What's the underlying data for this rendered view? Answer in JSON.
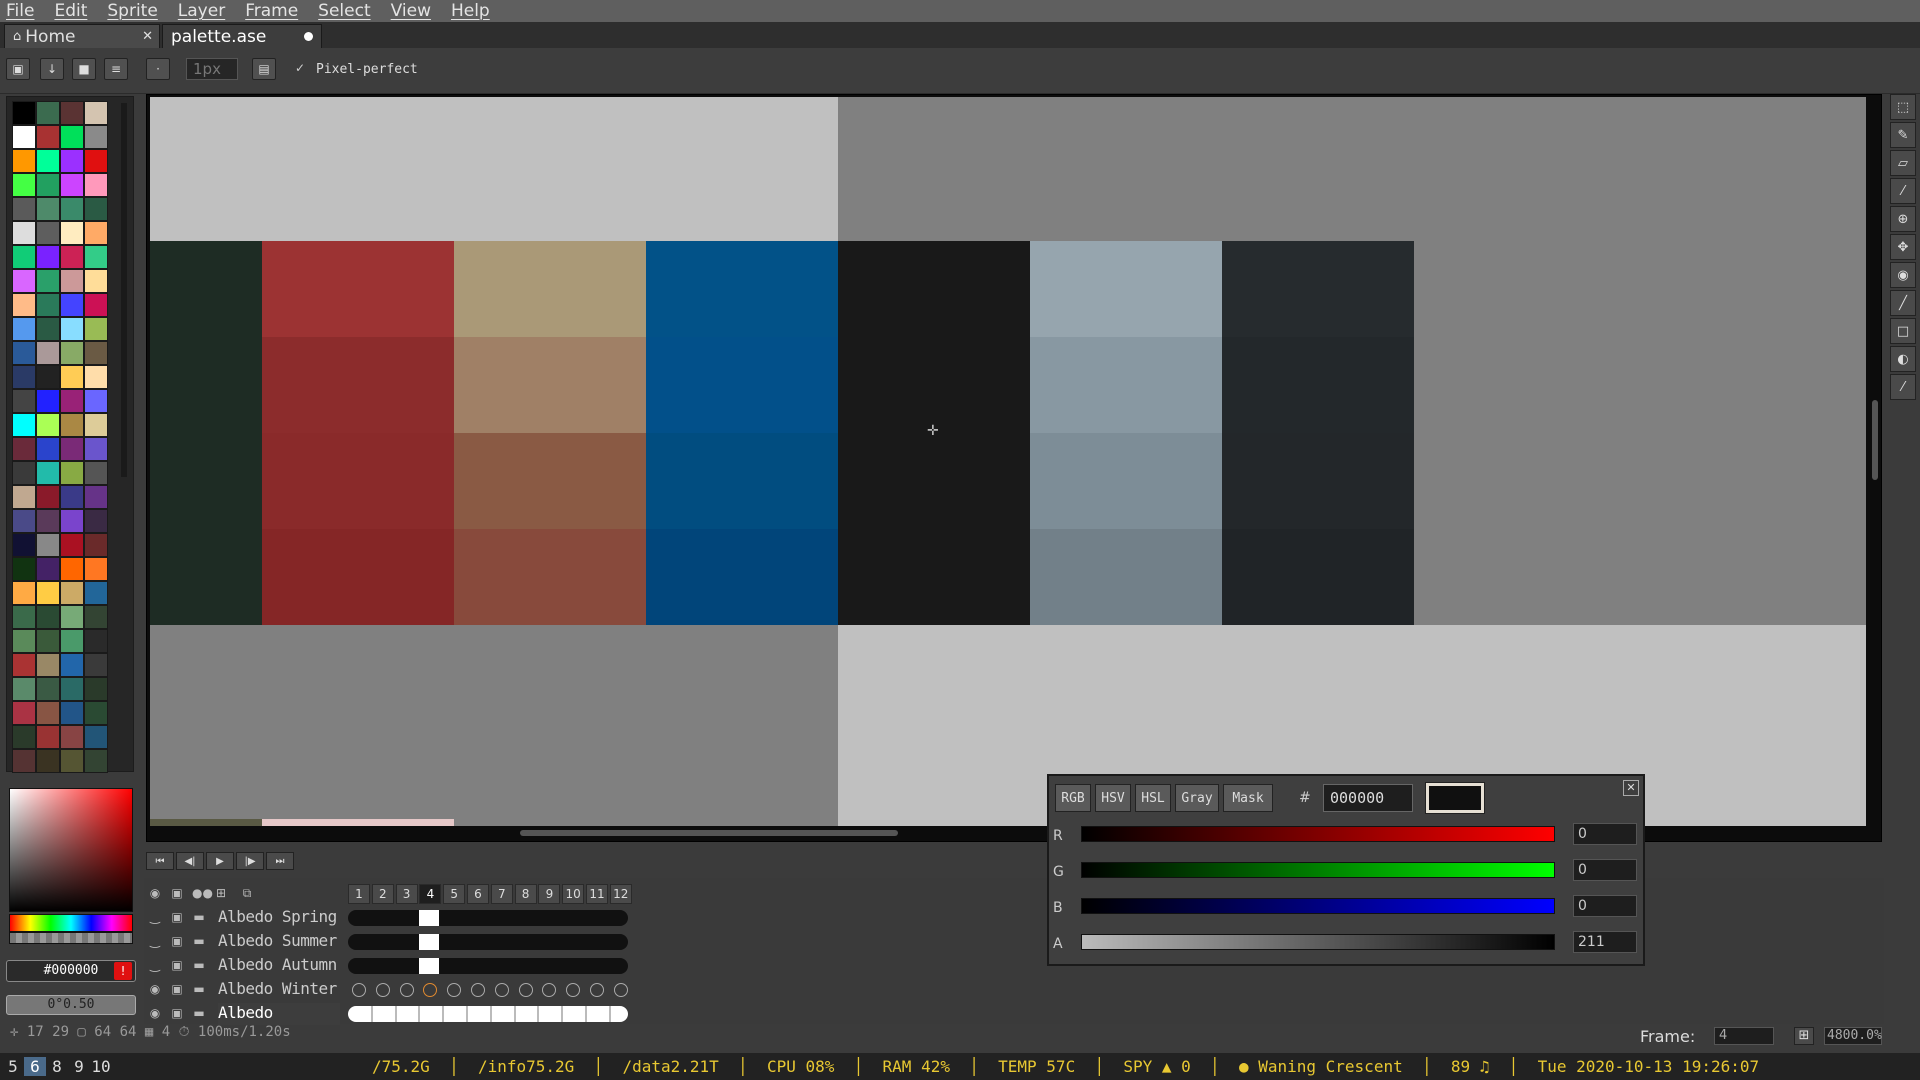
{
  "menu": [
    "File",
    "Edit",
    "Sprite",
    "Layer",
    "Frame",
    "Select",
    "View",
    "Help"
  ],
  "tabs": {
    "home": "Home",
    "file": "palette.ase"
  },
  "toolbar": {
    "brush_size": "1px",
    "pixel_perfect": "Pixel-perfect"
  },
  "palette": [
    "#000000",
    "#3b6b4f",
    "#5a3333",
    "#d4c4b0",
    "#ffffff",
    "#a83232",
    "#00e05a",
    "#8a8a8a",
    "#ff9800",
    "#00ff99",
    "#9b30ff",
    "#e01010",
    "#44ff44",
    "#22a060",
    "#cc44ff",
    "#ff99bb",
    "#5a5a5a",
    "#4e8a6a",
    "#3a8a6a",
    "#2a5a44",
    "#dddddd",
    "#5e5e5e",
    "#ffecc0",
    "#ffaa66",
    "#11cc77",
    "#7a22ff",
    "#cc2255",
    "#33cc88",
    "#d966ff",
    "#2aa06a",
    "#cc9999",
    "#ffdd99",
    "#ffbb88",
    "#2a7a5a",
    "#4444ff",
    "#cc1155",
    "#5599ee",
    "#2a5a44",
    "#88ddff",
    "#99bb55",
    "#2a5a99",
    "#aa9999",
    "#88aa66",
    "#6a5a44",
    "#2a3a66",
    "#222222",
    "#ffcc55",
    "#ffddaa",
    "#444444",
    "#2222ff",
    "#992277",
    "#6a66ff",
    "#00ffff",
    "#aaff55",
    "#aa8844",
    "#ddcc99",
    "#6a2a3a",
    "#2a44cc",
    "#7a2a77",
    "#6a55cc",
    "#3a3a3a",
    "#22bbaa",
    "#88aa44",
    "#555555",
    "#c0a890",
    "#8a1a2a",
    "#3a3a88",
    "#663388",
    "#4a4a88",
    "#5a3a5a",
    "#7a44cc",
    "#3a2a44",
    "#111133",
    "#888888",
    "#aa1122",
    "#6a2a2a",
    "#113311",
    "#442266",
    "#ff6600",
    "#ff7722",
    "#ffaa44",
    "#ffcc44",
    "#ccaa66",
    "#226699",
    "#3a6a4a",
    "#2a4a33",
    "#77aa77",
    "#334433",
    "#5a8a5a",
    "#3a5a3a",
    "#4a9a6a",
    "#2a2a2a",
    "#aa3333",
    "#998866",
    "#2266aa",
    "#3a3a3a",
    "#5a8a6a",
    "#3a5a44",
    "#2a6a66",
    "#2a3a2a",
    "#aa3344",
    "#885544",
    "#225588",
    "#2a4a33",
    "#2a3a2a",
    "#993333",
    "#884444",
    "#225577",
    "#553333",
    "#3a3322",
    "#555533",
    "#334433"
  ],
  "color_picker": {
    "hex": "#000000",
    "tolerance": "0°0.50"
  },
  "canvas": {
    "colors": {
      "dark_green": "#1e2c24",
      "red": [
        "#9c3333",
        "#8c2c2c",
        "#8a2a2a",
        "#852626"
      ],
      "tan": [
        "#aa9977",
        "#a08066",
        "#8a5a44",
        "#884a3c"
      ],
      "blue": [
        "#025288",
        "#02508a",
        "#014d80",
        "#01457a"
      ],
      "black": "#191919",
      "grey": [
        "#96a5ae",
        "#8898a2",
        "#7d8d97",
        "#728089"
      ],
      "charcoal": [
        "#262b2e",
        "#23282b",
        "#23272a",
        "#202427"
      ]
    }
  },
  "playback": [
    "⏮",
    "◀|",
    "▶",
    "|▶",
    "⏭"
  ],
  "frames": [
    "1",
    "2",
    "3",
    "4",
    "5",
    "6",
    "7",
    "8",
    "9",
    "10",
    "11",
    "12"
  ],
  "current_frame_index": 3,
  "layers": [
    {
      "name": "Albedo Spring"
    },
    {
      "name": "Albedo Summer"
    },
    {
      "name": "Albedo Autumn"
    },
    {
      "name": "Albedo Winter"
    },
    {
      "name": "Albedo"
    }
  ],
  "status": {
    "text": "✛ 17 29 ▢ 64 64 ▦ 4 ⏱ 100ms/1.20s",
    "frame_label": "Frame:",
    "frame_value": "4",
    "zoom": "4800.0%"
  },
  "popup": {
    "modes": [
      "RGB",
      "HSV",
      "HSL",
      "Gray",
      "Mask"
    ],
    "hash": "#",
    "hex": "000000",
    "channels": [
      {
        "label": "R",
        "value": "0"
      },
      {
        "label": "G",
        "value": "0"
      },
      {
        "label": "B",
        "value": "0"
      },
      {
        "label": "A",
        "value": "211"
      }
    ]
  },
  "wm": {
    "workspaces": [
      "5",
      "6",
      "8",
      "9",
      "10"
    ],
    "current": "6",
    "text": "/75.2G  │  /info75.2G  │  /data2.21T  │  CPU 08%  │  RAM 42%  │  TEMP 57C  │  SPY ▲ 0  │  ● Waning Crescent  │  89 ♫  │  Tue 2020-10-13 19:26:07"
  }
}
